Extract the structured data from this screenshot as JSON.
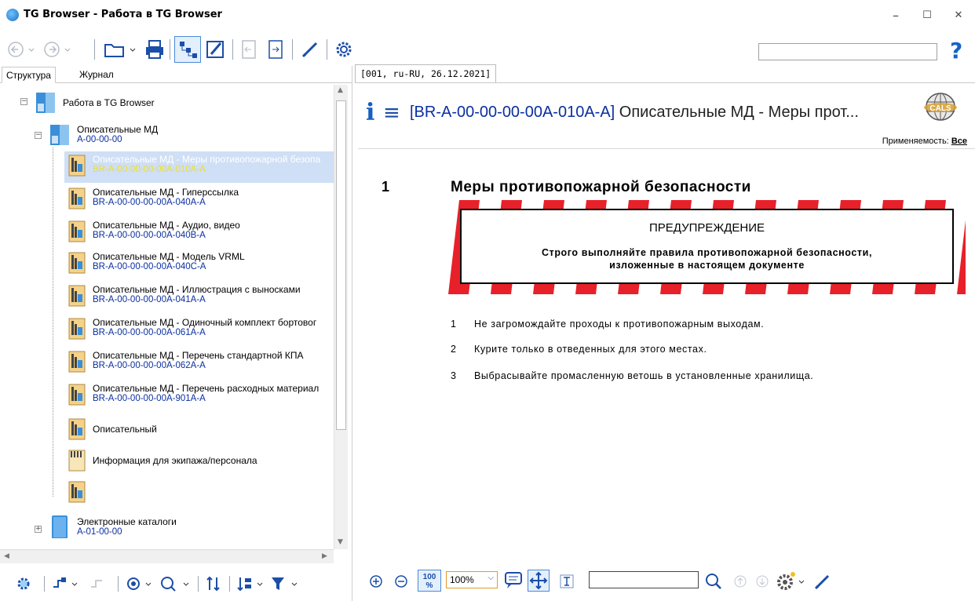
{
  "window": {
    "title": "TG Browser - Работа в TG Browser",
    "minimize": "–",
    "maximize": "☐",
    "close": "✕"
  },
  "toolbar": {
    "search_value": "",
    "buttons": [
      "back-icon",
      "forward-icon",
      "open-folder-icon",
      "print-icon",
      "tree-view-icon",
      "edit-icon",
      "prev-doc-icon",
      "next-doc-icon",
      "pen-icon",
      "settings-icon"
    ],
    "help_label": "?"
  },
  "left": {
    "tabs": [
      {
        "label": "Структура",
        "active": true
      },
      {
        "label": "Журнал",
        "active": false
      }
    ],
    "tree": {
      "root": {
        "label": "Работа в TG Browser"
      },
      "group": {
        "label": "Описательные МД",
        "code": "A-00-00-00"
      },
      "items": [
        {
          "label": "Описательные МД - Меры противопожарной безопа",
          "code": "BR-A-00-00-00-00A-010A-A",
          "selected": true
        },
        {
          "label": "Описательные МД - Гиперссылка",
          "code": "BR-A-00-00-00-00A-040A-A"
        },
        {
          "label": "Описательные МД - Аудио, видео",
          "code": "BR-A-00-00-00-00A-040B-A"
        },
        {
          "label": "Описательные МД - Модель VRML",
          "code": "BR-A-00-00-00-00A-040C-A"
        },
        {
          "label": "Описательные МД - Иллюстрация с выносками",
          "code": "BR-A-00-00-00-00A-041A-A"
        },
        {
          "label": "Описательные МД - Одиночный комплект бортовог",
          "code": "BR-A-00-00-00-00A-061A-A"
        },
        {
          "label": "Описательные МД - Перечень стандартной КПА",
          "code": "BR-A-00-00-00-00A-062A-A"
        },
        {
          "label": "Описательные МД - Перечень расходных материал",
          "code": "BR-A-00-00-00-00A-901A-A"
        }
      ],
      "plain_items": [
        {
          "label": "Описательный"
        },
        {
          "label": "Информация для экипажа/персонала"
        },
        {
          "label": ""
        }
      ],
      "catalog": {
        "label": "Электронные каталоги",
        "code": "A-01-00-00"
      }
    }
  },
  "right": {
    "tab_label": "[001, ru-RU, 26.12.2021]",
    "header": {
      "code": "[BR-A-00-00-00-00A-010A-A]",
      "title": "Описательные МД - Меры прот...",
      "applicability_label": "Применяемость:",
      "applicability_value": "Все"
    },
    "section": {
      "number": "1",
      "title": "Меры противопожарной безопасности"
    },
    "warning": {
      "heading": "ПРЕДУПРЕЖДЕНИЕ",
      "line1": "Строго выполняйте правила противопожарной безопасности,",
      "line2": "изложенные в настоящем документе"
    },
    "list": [
      {
        "num": "1",
        "text": "Не загромождайте проходы к противопожарным выходам."
      },
      {
        "num": "2",
        "text": "Курите только в отведенных для этого местах."
      },
      {
        "num": "3",
        "text": "Выбрасывайте промасленную ветошь в установленные хранилища."
      }
    ],
    "bottom": {
      "zoom_value": "100%",
      "find_value": ""
    }
  },
  "colors": {
    "accent": "#1560c0",
    "code_text": "#0a2fa0",
    "selection": "#cfdff5",
    "warning_stripe": "#e8202a"
  }
}
